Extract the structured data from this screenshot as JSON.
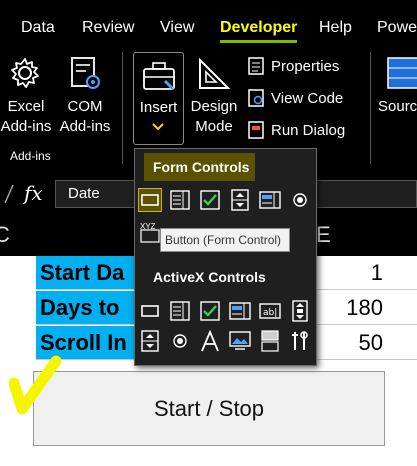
{
  "menu": {
    "tabs": [
      "Data",
      "Review",
      "View",
      "Developer",
      "Help",
      "Powe"
    ],
    "active": "Developer"
  },
  "ribbon": {
    "excel_addins": [
      "Excel",
      "Add-ins"
    ],
    "com_addins": [
      "COM",
      "Add-ins"
    ],
    "group_addins": "Add-ins",
    "insert": "Insert",
    "design_mode": [
      "Design",
      "Mode"
    ],
    "properties": "Properties",
    "view_code": "View Code",
    "run_dialog": "Run Dialog",
    "source": "Sourc"
  },
  "formula_bar": {
    "fx": "fx",
    "value": "Date"
  },
  "columns": {
    "left": "C",
    "right": "E"
  },
  "cells": [
    {
      "label": "Start Da",
      "value": "1"
    },
    {
      "label": "Days to",
      "value": "180"
    },
    {
      "label": "Scroll In",
      "value": "50"
    }
  ],
  "start_stop_label": "Start / Stop",
  "dropdown": {
    "form_controls_title": "Form Controls",
    "activex_title": "ActiveX Controls",
    "tooltip": "Button (Form Control)",
    "xyz_label": "XYZ"
  },
  "colors": {
    "accent": "#7fba00",
    "cell_fill": "#00b0f0",
    "selection": "#c9b800",
    "highlight": "#ffff00"
  }
}
